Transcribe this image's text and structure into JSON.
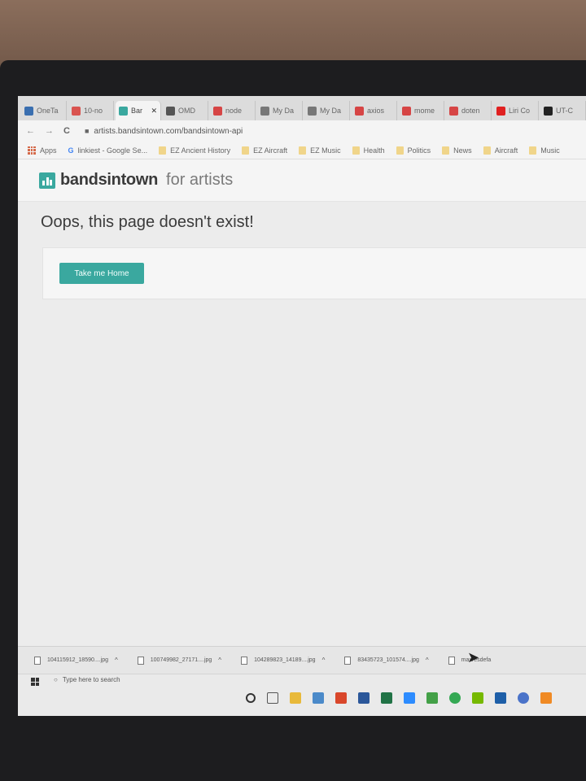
{
  "browser": {
    "tabs": [
      {
        "label": "OneTa",
        "icon": "v-icon",
        "color": "#3a6fb0"
      },
      {
        "label": "10-no",
        "icon": "heart-icon",
        "color": "#d9534f"
      },
      {
        "label": "Bar",
        "icon": "bandsintown-icon",
        "color": "#3aa89f",
        "active": true,
        "close": "✕"
      },
      {
        "label": "OMD",
        "icon": "paw-icon",
        "color": "#555555"
      },
      {
        "label": "node",
        "icon": "n-box-icon",
        "color": "#d64545"
      },
      {
        "label": "My Da",
        "icon": "circle-icon",
        "color": "#777777"
      },
      {
        "label": "My Da",
        "icon": "circle-icon",
        "color": "#777777"
      },
      {
        "label": "axios",
        "icon": "n-box-icon",
        "color": "#d64545"
      },
      {
        "label": "mome",
        "icon": "n-box-icon",
        "color": "#d64545"
      },
      {
        "label": "doten",
        "icon": "n-box-icon",
        "color": "#d64545"
      },
      {
        "label": "Liri Co",
        "icon": "youtube-icon",
        "color": "#e02020"
      },
      {
        "label": "UT-C",
        "icon": "github-icon",
        "color": "#222222"
      }
    ],
    "nav": {
      "back": "←",
      "forward": "→",
      "reload": "C",
      "lock": "🔒",
      "url": "artists.bandsintown.com/bandsintown-api"
    },
    "bookmarks": [
      {
        "label": "Apps",
        "type": "apps"
      },
      {
        "label": "linkiest - Google Se...",
        "type": "google"
      },
      {
        "label": "EZ Ancient History",
        "type": "folder"
      },
      {
        "label": "EZ Aircraft",
        "type": "folder"
      },
      {
        "label": "EZ Music",
        "type": "folder"
      },
      {
        "label": "Health",
        "type": "folder"
      },
      {
        "label": "Politics",
        "type": "folder"
      },
      {
        "label": "News",
        "type": "folder"
      },
      {
        "label": "Aircraft",
        "type": "folder"
      },
      {
        "label": "Music",
        "type": "folder"
      }
    ],
    "google_g": "G"
  },
  "page": {
    "brand": "bandsintown",
    "brand_sub": "for artists",
    "title": "Oops, this page doesn't exist!",
    "home_button": "Take me Home",
    "accent": "#3aa89f"
  },
  "downloads": [
    {
      "name": "104115912_18590....jpg",
      "chevron": "^"
    },
    {
      "name": "100749982_27171....jpg",
      "chevron": "^"
    },
    {
      "name": "104289823_14189....jpg",
      "chevron": "^"
    },
    {
      "name": "83435723_101574....jpg",
      "chevron": "^"
    },
    {
      "name": "maxresdefa"
    }
  ],
  "taskbar": {
    "search_placeholder": "Type here to search",
    "search_icon": "○"
  }
}
